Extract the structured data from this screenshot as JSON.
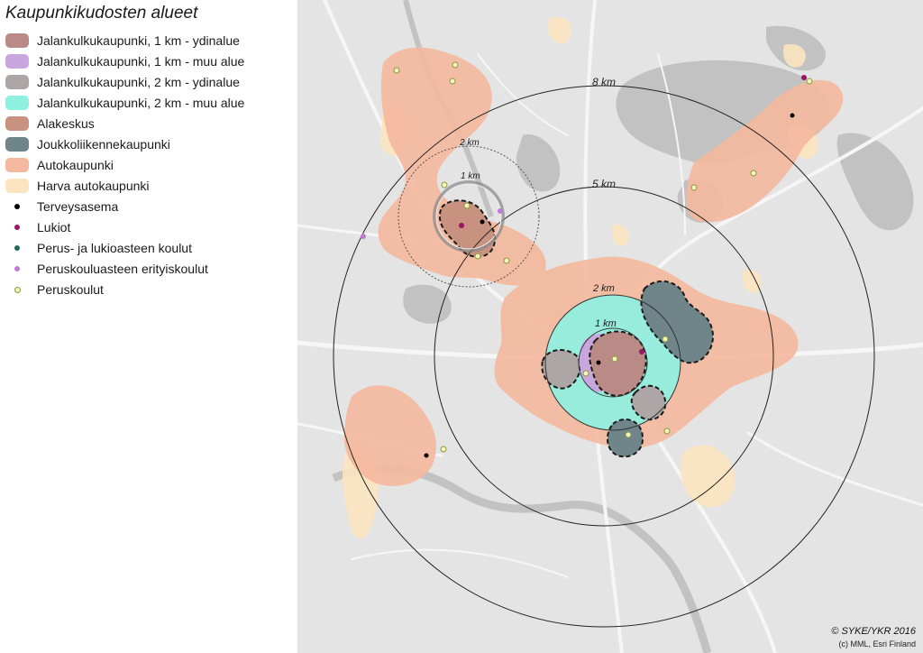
{
  "legend": {
    "title": "Kaupunkikudosten alueet",
    "items": [
      {
        "label": "Jalankulkukaupunki, 1 km - ydinalue",
        "type": "swatch",
        "color": "#b98a86"
      },
      {
        "label": "Jalankulkukaupunki, 1 km - muu alue",
        "type": "swatch",
        "color": "#c9a6dd"
      },
      {
        "label": "Jalankulkukaupunki, 2 km - ydinalue",
        "type": "swatch",
        "color": "#aca6a6"
      },
      {
        "label": "Jalankulkukaupunki, 2 km - muu alue",
        "type": "swatch",
        "color": "#8ff0e0"
      },
      {
        "label": "Alakeskus",
        "type": "swatch",
        "color": "#c99280"
      },
      {
        "label": "Joukkoliikennekaupunki",
        "type": "swatch",
        "color": "#70858a"
      },
      {
        "label": "Autokaupunki",
        "type": "swatch",
        "color": "#f4b99e"
      },
      {
        "label": "Harva autokaupunki",
        "type": "swatch",
        "color": "#fbe4bf"
      },
      {
        "label": "Terveysasema",
        "type": "dot",
        "color": "#000000"
      },
      {
        "label": "Lukiot",
        "type": "dot",
        "color": "#9b1466"
      },
      {
        "label": "Perus- ja lukioasteen koulut",
        "type": "dot",
        "color": "#1d6b54"
      },
      {
        "label": "Peruskouluasteen erityiskoulut",
        "type": "dot",
        "color": "#c378d6"
      },
      {
        "label": "Peruskoulut",
        "type": "dot-outline",
        "color": "#f2f5c0"
      }
    ]
  },
  "map": {
    "ring_labels": {
      "r8km": "8 km",
      "r5km": "5 km",
      "r2km_main": "2 km",
      "r1km_main": "1 km",
      "r2km_sub": "2 km",
      "r1km_sub": "1 km"
    },
    "credits": {
      "line1": "© SYKE/YKR 2016",
      "line2": "(c) MML, Esri Finland"
    }
  }
}
